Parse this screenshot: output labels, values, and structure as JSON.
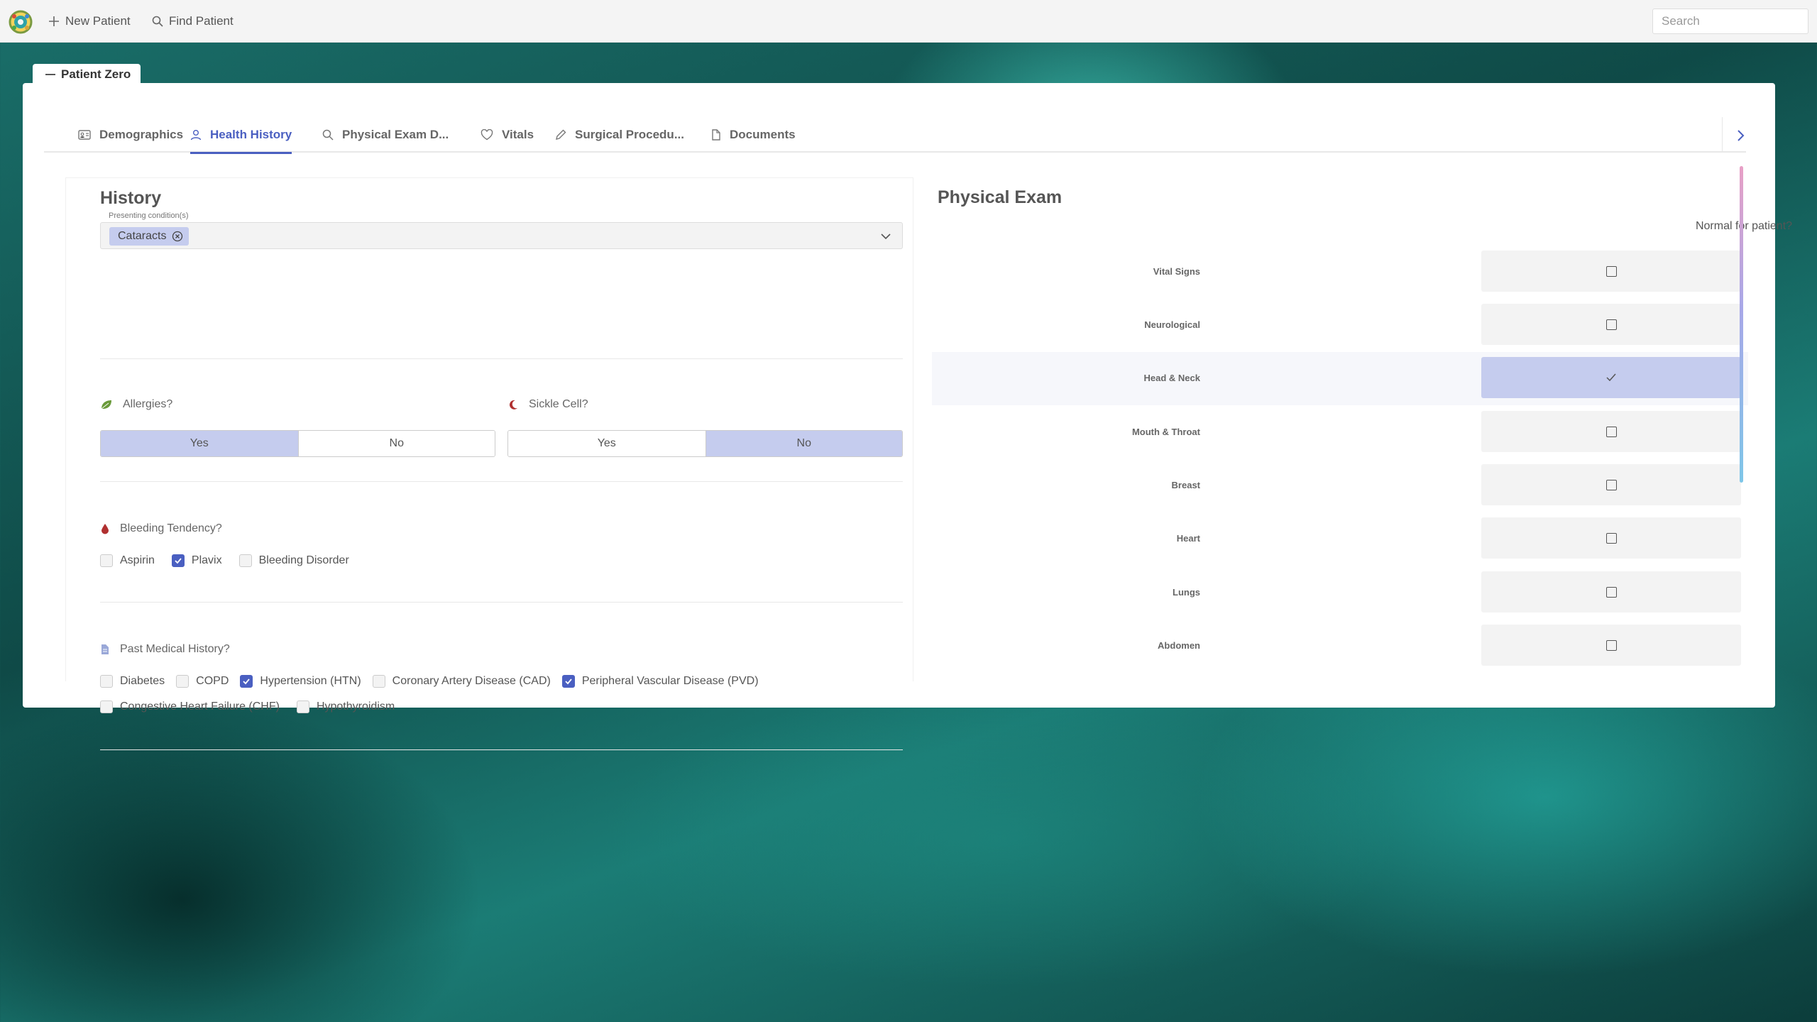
{
  "topbar": {
    "new_patient": "New Patient",
    "find_patient": "Find Patient",
    "search_placeholder": "Search"
  },
  "patient": {
    "name": "Patient Zero"
  },
  "tabs": [
    {
      "label": "Demographics",
      "icon": "id-card-icon"
    },
    {
      "label": "Health History",
      "icon": "user-icon",
      "active": true
    },
    {
      "label": "Physical Exam D...",
      "icon": "search-icon"
    },
    {
      "label": "Vitals",
      "icon": "heart-icon"
    },
    {
      "label": "Surgical Procedu...",
      "icon": "pencil-icon"
    },
    {
      "label": "Documents",
      "icon": "document-icon"
    }
  ],
  "history": {
    "title": "History",
    "presenting_label": "Presenting condition(s)",
    "presenting_chip": "Cataracts",
    "allergies": {
      "label": "Allergies?",
      "yes": "Yes",
      "no": "No",
      "selected": "Yes"
    },
    "sickle": {
      "label": "Sickle Cell?",
      "yes": "Yes",
      "no": "No",
      "selected": "No"
    },
    "bleeding": {
      "label": "Bleeding Tendency?",
      "options": [
        {
          "label": "Aspirin",
          "checked": false
        },
        {
          "label": "Plavix",
          "checked": true
        },
        {
          "label": "Bleeding Disorder",
          "checked": false
        }
      ]
    },
    "pmh": {
      "label": "Past Medical History?",
      "options": [
        {
          "label": "Diabetes",
          "checked": false
        },
        {
          "label": "COPD",
          "checked": false
        },
        {
          "label": "Hypertension (HTN)",
          "checked": true
        },
        {
          "label": "Coronary Artery Disease (CAD)",
          "checked": false
        },
        {
          "label": "Peripheral Vascular Disease (PVD)",
          "checked": true
        },
        {
          "label": "Congestive Heart Failure (CHF)",
          "checked": false
        },
        {
          "label": "Hypothyroidism",
          "checked": false
        }
      ]
    }
  },
  "exam": {
    "title": "Physical Exam",
    "normal_header": "Normal for patient?",
    "rows": [
      {
        "label": "Vital Signs",
        "normal": false
      },
      {
        "label": "Neurological",
        "normal": false
      },
      {
        "label": "Head & Neck",
        "normal": true
      },
      {
        "label": "Mouth & Throat",
        "normal": false
      },
      {
        "label": "Breast",
        "normal": false
      },
      {
        "label": "Heart",
        "normal": false
      },
      {
        "label": "Lungs",
        "normal": false
      },
      {
        "label": "Abdomen",
        "normal": false
      }
    ]
  },
  "colors": {
    "accent": "#4a5fc1",
    "selected_bg": "#c5ccee"
  }
}
